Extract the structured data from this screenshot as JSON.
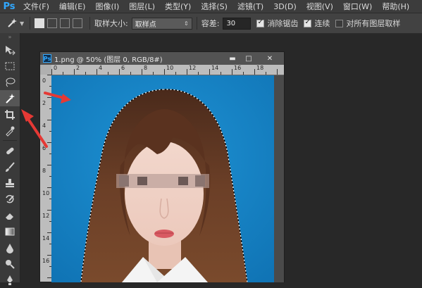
{
  "app": {
    "logo": "Ps"
  },
  "menu": [
    "文件(F)",
    "编辑(E)",
    "图像(I)",
    "图层(L)",
    "类型(Y)",
    "选择(S)",
    "滤镜(T)",
    "3D(D)",
    "视图(V)",
    "窗口(W)",
    "帮助(H)"
  ],
  "options": {
    "sample_size_label": "取样大小:",
    "sample_size_value": "取样点",
    "tolerance_label": "容差:",
    "tolerance_value": "30",
    "antialias_label": "消除锯齿",
    "antialias_checked": true,
    "contiguous_label": "连续",
    "contiguous_checked": true,
    "all_layers_label": "对所有图层取样",
    "all_layers_checked": false
  },
  "document": {
    "title": "1.png @ 50% (图层 0, RGB/8#)",
    "ps_badge": "Ps",
    "ruler_top": [
      "0",
      "2",
      "4",
      "6",
      "8",
      "10",
      "12",
      "14",
      "16",
      "18"
    ],
    "ruler_left": [
      "0",
      "2",
      "4",
      "6",
      "8",
      "10",
      "12",
      "14",
      "16"
    ]
  },
  "colors": {
    "background": "#1583c4",
    "accent": "#31a8ff",
    "annotation_arrow": "#e53935"
  },
  "tools": [
    "move-icon",
    "marquee-icon",
    "lasso-icon",
    "magic-wand-icon",
    "crop-icon",
    "eyedropper-icon",
    "healing-brush-icon",
    "brush-icon",
    "clone-stamp-icon",
    "history-brush-icon",
    "eraser-icon",
    "gradient-icon",
    "blur-icon",
    "dodge-icon",
    "pen-icon"
  ]
}
